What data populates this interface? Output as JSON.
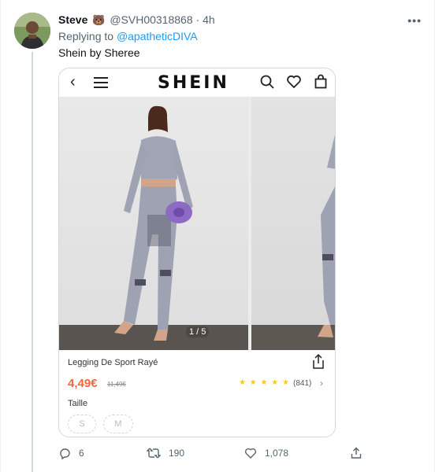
{
  "tweet": {
    "display_name": "Steve",
    "emoji": "🐻",
    "handle": "@SVH00318868",
    "separator": "·",
    "time": "4h",
    "replying_prefix": "Replying to",
    "replying_to": "@apatheticDIVA",
    "text": "Shein by Sheree",
    "more_icon": "more-horizontal-icon"
  },
  "shop": {
    "logo": "SHEIN",
    "back_icon": "‹",
    "image_counter": "1 / 5",
    "product_name": "Legging De Sport Rayé",
    "price": "4,49€",
    "old_price": "11,49€",
    "stars": "★ ★ ★ ★ ★",
    "rating": 5,
    "reviews": "(841)",
    "chevron": "›",
    "size_label": "Taille",
    "sizes": [
      "S",
      "M"
    ]
  },
  "actions": {
    "replies": "6",
    "retweets": "190",
    "likes": "1,078"
  },
  "colors": {
    "accent": "#1d9bf0",
    "price": "#fa6338",
    "star": "#facc15",
    "muted": "#536471"
  }
}
